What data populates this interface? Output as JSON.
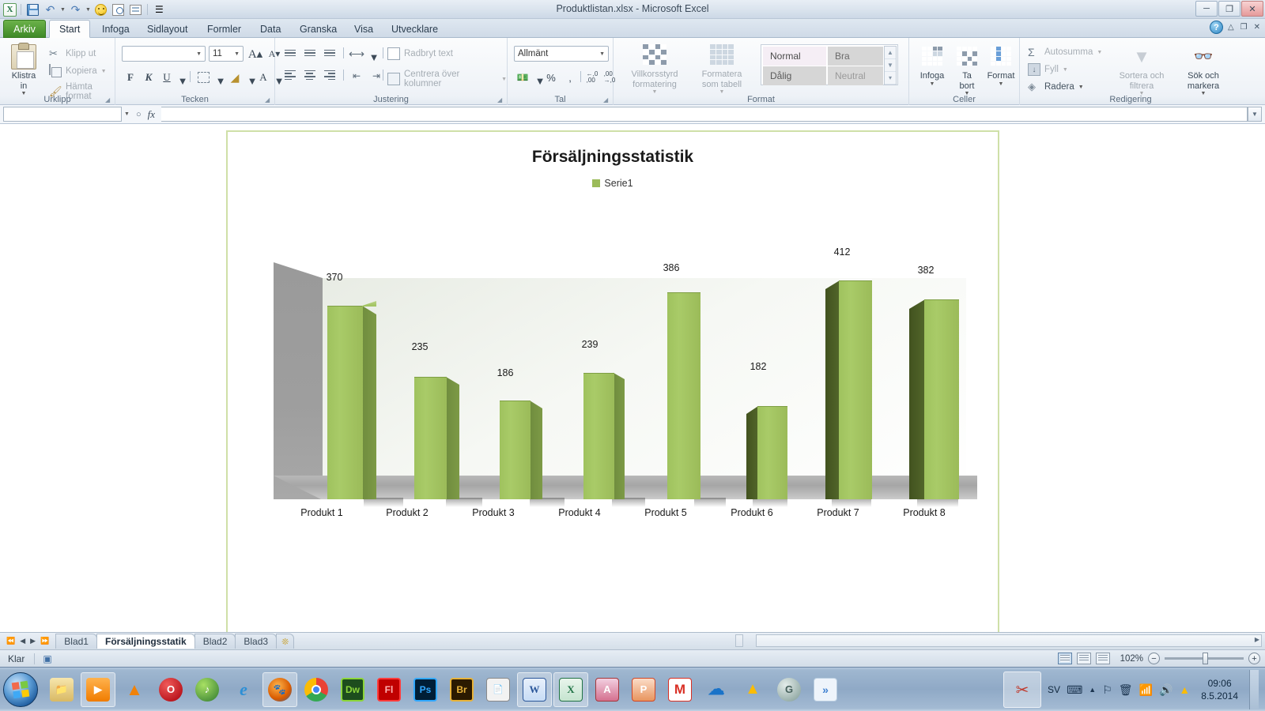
{
  "window": {
    "title": "Produktlistan.xlsx  -  Microsoft Excel",
    "minimize": "0",
    "restore": "1",
    "close": "✕"
  },
  "quick_access": {
    "icons": [
      "excel-logo",
      "save-icon",
      "undo-icon",
      "redo-icon",
      "smiley-icon",
      "print-preview-icon",
      "list-icon",
      "customize-icon"
    ]
  },
  "ribbon_tabs": [
    {
      "label": "Arkiv",
      "type": "file"
    },
    {
      "label": "Start",
      "type": "active"
    },
    {
      "label": "Infoga",
      "type": "normal"
    },
    {
      "label": "Sidlayout",
      "type": "normal"
    },
    {
      "label": "Formler",
      "type": "normal"
    },
    {
      "label": "Data",
      "type": "normal"
    },
    {
      "label": "Granska",
      "type": "normal"
    },
    {
      "label": "Visa",
      "type": "normal"
    },
    {
      "label": "Utvecklare",
      "type": "normal"
    }
  ],
  "ribbon": {
    "clipboard": {
      "group_label": "Urklipp",
      "paste_label": "Klistra\nin",
      "cut_label": "Klipp ut",
      "copy_label": "Kopiera",
      "format_painter_label": "Hämta format"
    },
    "font": {
      "group_label": "Tecken",
      "font_name": "",
      "font_size": "11",
      "bold": "F",
      "italic": "K",
      "underline": "U",
      "grow_font": "A",
      "shrink_font": "A",
      "borders": "borders-icon",
      "fill_color": "fill-color-icon",
      "font_color": "A"
    },
    "alignment": {
      "group_label": "Justering",
      "wrap_text_label": "Radbryt text",
      "merge_center_label": "Centrera över kolumner"
    },
    "number": {
      "group_label": "Tal",
      "format_value": "Allmänt",
      "percent": "%",
      "comma": ",",
      "decrease_decimal": "←,0",
      "increase_decimal": ",00"
    },
    "styles": {
      "group_label": "Format",
      "conditional_label": "Villkorsstyrd\nformatering",
      "table_label": "Formatera\nsom tabell",
      "cell_styles": [
        "Normal",
        "Bra",
        "Dålig",
        "Neutral"
      ]
    },
    "cells": {
      "group_label": "Celler",
      "insert_label": "Infoga",
      "delete_label": "Ta\nbort",
      "format_label": "Format"
    },
    "editing": {
      "group_label": "Redigering",
      "autosum_label": "Autosumma",
      "fill_label": "Fyll",
      "clear_label": "Radera",
      "sort_filter_label": "Sortera och\nfiltrera",
      "find_select_label": "Sök och\nmarkera"
    }
  },
  "formula_bar": {
    "name_box": "",
    "fx": "fx",
    "value": ""
  },
  "chart_data": {
    "type": "bar",
    "title": "Försäljningsstatistik",
    "legend": [
      "Serie1"
    ],
    "legend_position": "top",
    "categories": [
      "Produkt 1",
      "Produkt 2",
      "Produkt 3",
      "Produkt 4",
      "Produkt 5",
      "Produkt 6",
      "Produkt 7",
      "Produkt 8"
    ],
    "values": [
      370,
      235,
      186,
      239,
      386,
      182,
      412,
      382
    ],
    "xlabel": "",
    "ylabel": "",
    "ylim": [
      0,
      450
    ],
    "grid": false,
    "series_color": "#9bbb59",
    "three_d": true
  },
  "sheet_tabs": [
    {
      "label": "Blad1",
      "active": false
    },
    {
      "label": "Försäljningsstatik",
      "active": true
    },
    {
      "label": "Blad2",
      "active": false
    },
    {
      "label": "Blad3",
      "active": false
    }
  ],
  "status_bar": {
    "mode": "Klar",
    "zoom": "102%",
    "zoom_out": "−",
    "zoom_in": "+"
  },
  "taskbar": {
    "apps": [
      {
        "name": "explorer",
        "label": "",
        "color": "#f0d89a"
      },
      {
        "name": "media-player",
        "label": "▶",
        "color": "#ff8c1a"
      },
      {
        "name": "vlc",
        "label": "",
        "color": "#ff8800"
      },
      {
        "name": "opera",
        "label": "O",
        "color": "#cc0f16"
      },
      {
        "name": "windows-media",
        "label": "",
        "color": "#4caf50"
      },
      {
        "name": "internet-explorer",
        "label": "e",
        "color": "#4aa3df"
      },
      {
        "name": "firefox",
        "label": "",
        "color": "#e66000"
      },
      {
        "name": "chrome",
        "label": "",
        "color": "#4285f4"
      },
      {
        "name": "dreamweaver",
        "label": "Dw",
        "color": "#1d4d1d"
      },
      {
        "name": "flash",
        "label": "Fl",
        "color": "#c00000"
      },
      {
        "name": "photoshop",
        "label": "Ps",
        "color": "#001e36"
      },
      {
        "name": "bridge",
        "label": "Br",
        "color": "#2b1a00"
      },
      {
        "name": "libreoffice",
        "label": "",
        "color": "#e8e8e8"
      },
      {
        "name": "word",
        "label": "W",
        "color": "#2b579a"
      },
      {
        "name": "excel",
        "label": "X",
        "color": "#217346"
      },
      {
        "name": "access",
        "label": "A",
        "color": "#a4373a"
      },
      {
        "name": "powerpoint",
        "label": "P",
        "color": "#d24726"
      },
      {
        "name": "gmail",
        "label": "M",
        "color": "#d93025"
      },
      {
        "name": "onedrive",
        "label": "",
        "color": "#0a66c2"
      },
      {
        "name": "google-drive",
        "label": "",
        "color": "#fbbc04"
      },
      {
        "name": "gecko",
        "label": "G",
        "color": "#8fa8a0"
      },
      {
        "name": "overflow",
        "label": "»",
        "color": "#3d7fd1"
      }
    ],
    "snipping_tool": "snipping-tool-icon",
    "tray": {
      "language": "SV",
      "icons": [
        "keyboard-icon",
        "show-hidden-icon",
        "flag-icon",
        "action-center-icon",
        "network-icon",
        "volume-icon",
        "google-drive-icon"
      ],
      "time": "09:06",
      "date": "8.5.2014"
    }
  }
}
